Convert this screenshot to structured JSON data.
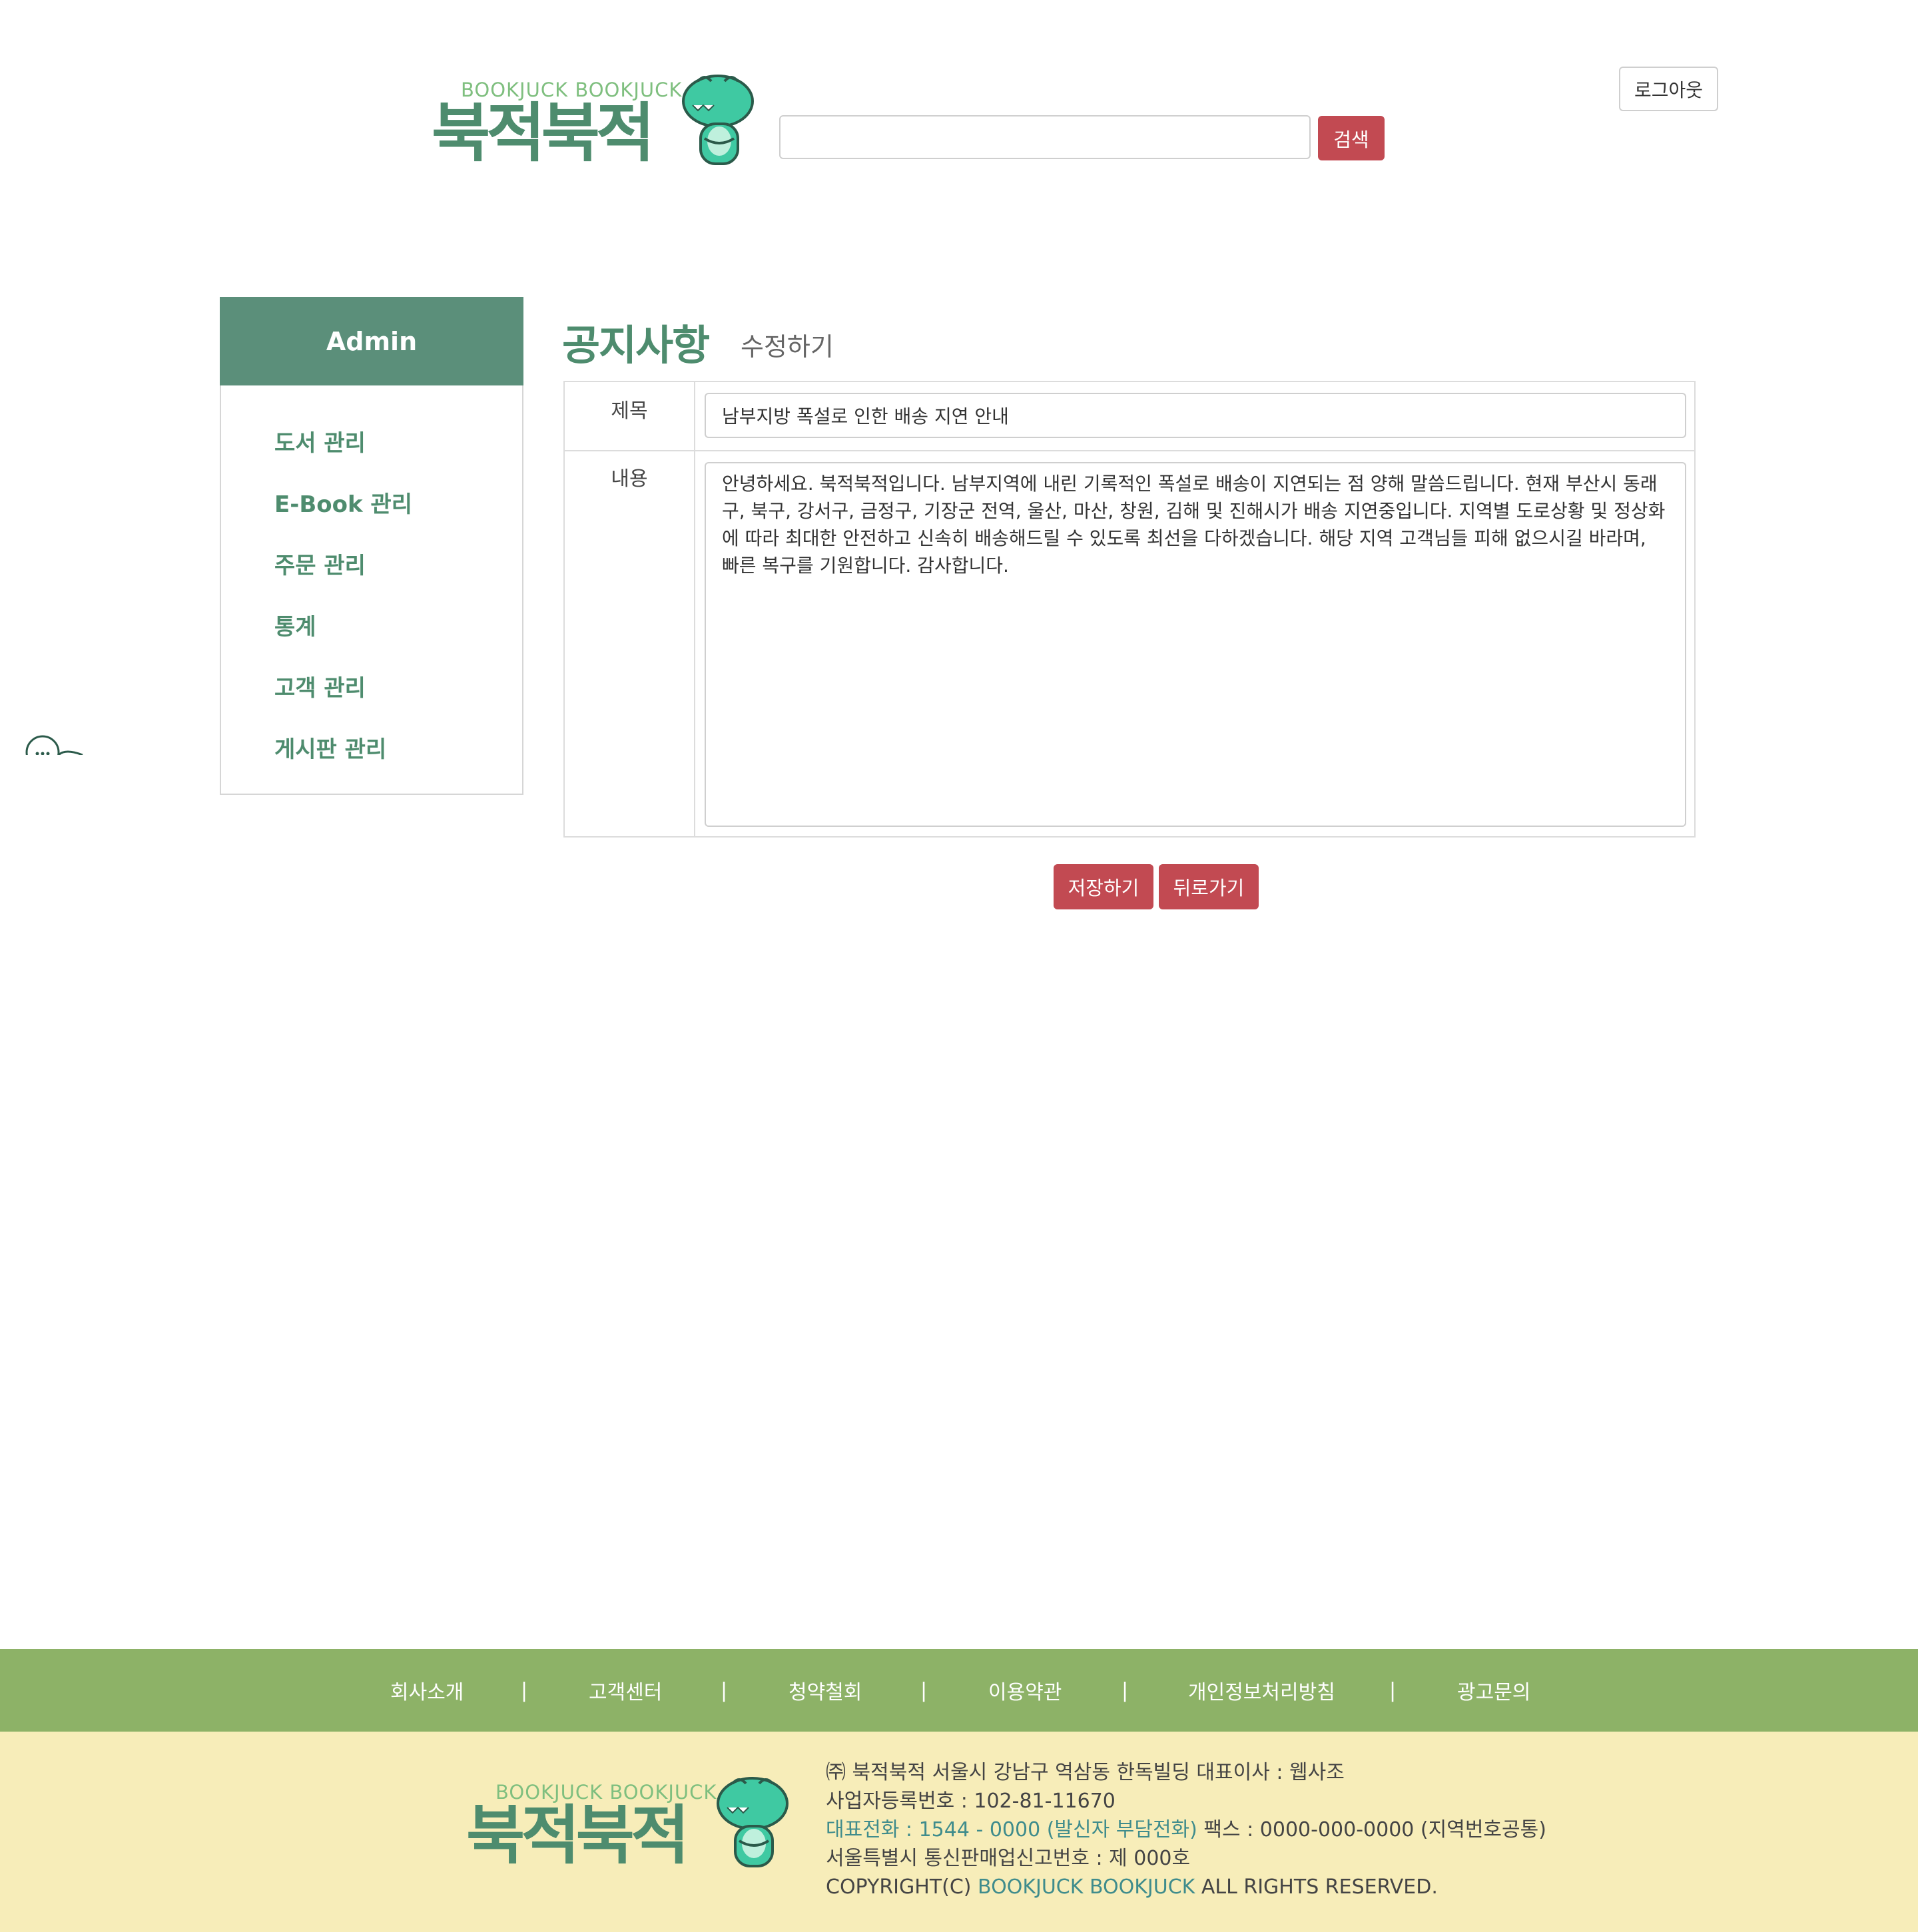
{
  "header": {
    "logo_en": "BOOKJUCK BOOKJUCK",
    "logo_ko": "북적북적",
    "search_value": "",
    "search_button": "검색",
    "logout_button": "로그아웃"
  },
  "sidebar": {
    "title": "Admin",
    "items": [
      {
        "label": "도서 관리"
      },
      {
        "label": "E-Book 관리"
      },
      {
        "label": "주문 관리"
      },
      {
        "label": "통계"
      },
      {
        "label": "고객 관리"
      },
      {
        "label": "게시판 관리"
      }
    ]
  },
  "main": {
    "title": "공지사항",
    "subtitle": "수정하기",
    "form": {
      "title_label": "제목",
      "title_value": "남부지방 폭설로 인한 배송 지연 안내",
      "content_label": "내용",
      "content_value": "안녕하세요. 북적북적입니다. 남부지역에 내린 기록적인 폭설로 배송이 지연되는 점 양해 말씀드립니다. 현재 부산시 동래구, 북구, 강서구, 금정구, 기장군 전역, 울산, 마산, 창원, 김해 및 진해시가 배송 지연중입니다. 지역별 도로상황 및 정상화에 따라 최대한 안전하고 신속히 배송해드릴 수 있도록 최선을 다하겠습니다. 해당 지역 고객님들 피해 없으시길 바라며, 빠른 복구를 기원합니다. 감사합니다."
    },
    "save_button": "저장하기",
    "back_button": "뒤로가기"
  },
  "footer_nav": {
    "items": [
      "회사소개",
      "고객센터",
      "청약철회",
      "이용약관",
      "개인정보처리방침",
      "광고문의"
    ],
    "separator": "|"
  },
  "footer": {
    "logo_en": "BOOKJUCK BOOKJUCK",
    "logo_ko": "북적북적",
    "line1": "㈜ 북적북적   서울시 강남구 역삼동 한독빌딩   대표이사 : 웹사조",
    "line2": "사업자등록번호 : 102-81-11670",
    "line3_phone": "대표전화 : 1544 - 0000 (발신자 부담전화)",
    "line3_fax": "팩스 : 0000-000-0000 (지역번호공통)",
    "line4": "서울특별시 통신판매업신고번호 : 제 000호",
    "line5_prefix": "COPYRIGHT(C) ",
    "line5_brand": "BOOKJUCK BOOKJUCK",
    "line5_suffix": " ALL RIGHTS RESERVED."
  },
  "colors": {
    "brand_green": "#4e8c6e",
    "sidebar_head": "#5b8f7a",
    "button_red": "#c24a52",
    "footer_nav_bg": "#8db267",
    "footer_bg": "#f7edb9"
  }
}
